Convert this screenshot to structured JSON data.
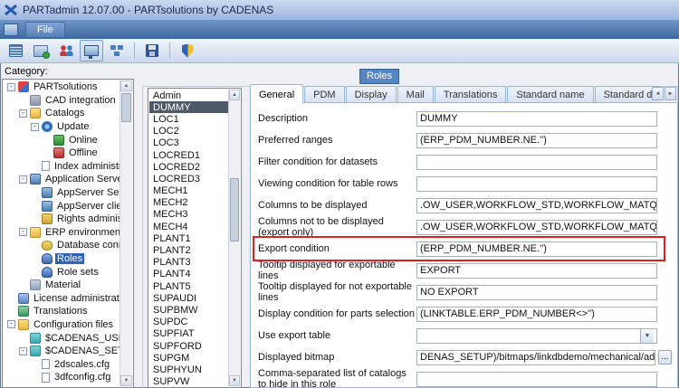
{
  "window": {
    "title": "PARTadmin 12.07.00 - PARTsolutions by CADENAS"
  },
  "menu": {
    "items": [
      {
        "label": "File"
      }
    ]
  },
  "toolbar": {
    "buttons": [
      {
        "name": "catalog-stack-icon"
      },
      {
        "name": "transfer-icon"
      },
      {
        "name": "users-icon"
      },
      {
        "name": "index-monitor-icon",
        "pressed": true
      },
      {
        "name": "network-icon"
      },
      {
        "separator": true
      },
      {
        "name": "save-icon"
      },
      {
        "separator": true
      },
      {
        "name": "shield-icon"
      }
    ]
  },
  "sidebar": {
    "category_label": "Category:",
    "tree": [
      {
        "label": "PARTsolutions",
        "level": 0,
        "expander": true,
        "icon": "app"
      },
      {
        "label": "CAD integration",
        "level": 1,
        "expander": false,
        "icon": "module"
      },
      {
        "label": "Catalogs",
        "level": 1,
        "expander": true,
        "icon": "folder"
      },
      {
        "label": "Update",
        "level": 2,
        "expander": true,
        "icon": "update"
      },
      {
        "label": "Online",
        "level": 3,
        "expander": false,
        "icon": "online"
      },
      {
        "label": "Offline",
        "level": 3,
        "expander": false,
        "icon": "offline"
      },
      {
        "label": "Index administration",
        "level": 2,
        "expander": false,
        "icon": "doc"
      },
      {
        "label": "Application Server",
        "level": 1,
        "expander": true,
        "icon": "server"
      },
      {
        "label": "AppServer Service",
        "level": 2,
        "expander": false,
        "icon": "server"
      },
      {
        "label": "AppServer client",
        "level": 2,
        "expander": false,
        "icon": "server"
      },
      {
        "label": "Rights administration",
        "level": 2,
        "expander": false,
        "icon": "key"
      },
      {
        "label": "ERP environment",
        "level": 1,
        "expander": true,
        "icon": "folder"
      },
      {
        "label": "Database connection",
        "level": 2,
        "expander": false,
        "icon": "db"
      },
      {
        "label": "Roles",
        "level": 2,
        "expander": false,
        "icon": "role",
        "selected": true
      },
      {
        "label": "Role sets",
        "level": 2,
        "expander": false,
        "icon": "role"
      },
      {
        "label": "Material",
        "level": 1,
        "expander": false,
        "icon": "material"
      },
      {
        "label": "License administration",
        "level": 0,
        "expander": false,
        "icon": "license"
      },
      {
        "label": "Translations",
        "level": 0,
        "expander": false,
        "icon": "trans"
      },
      {
        "label": "Configuration files",
        "level": 0,
        "expander": true,
        "icon": "folder"
      },
      {
        "label": "$CADENAS_USER",
        "level": 1,
        "expander": false,
        "icon": "folder-open"
      },
      {
        "label": "$CADENAS_SETUP",
        "level": 1,
        "expander": true,
        "icon": "folder-open"
      },
      {
        "label": "2dscales.cfg",
        "level": 2,
        "expander": false,
        "icon": "cfg"
      },
      {
        "label": "3dfconfig.cfg",
        "level": 2,
        "expander": false,
        "icon": "cfg"
      }
    ]
  },
  "group": {
    "title": "Roles"
  },
  "roles_list": {
    "selected": "DUMMY",
    "items": [
      "Admin",
      "DUMMY",
      "LOC1",
      "LOC2",
      "LOC3",
      "LOCRED1",
      "LOCRED2",
      "LOCRED3",
      "MECH1",
      "MECH2",
      "MECH3",
      "MECH4",
      "PLANT1",
      "PLANT2",
      "PLANT3",
      "PLANT4",
      "PLANT5",
      "SUPAUDI",
      "SUPBMW",
      "SUPDC",
      "SUPFIAT",
      "SUPFORD",
      "SUPGM",
      "SUPHYUN",
      "SUPVW"
    ]
  },
  "tabs": {
    "active": "General",
    "items": [
      "General",
      "PDM",
      "Display",
      "Mail",
      "Translations",
      "Standard name",
      "Standard designation"
    ]
  },
  "form": {
    "rows": [
      {
        "label": "Description",
        "value": "DUMMY",
        "type": "text"
      },
      {
        "label": "Preferred ranges",
        "value": "(ERP_PDM_NUMBER.NE.'')",
        "type": "text"
      },
      {
        "label": "Filter condition for datasets",
        "value": "",
        "type": "text"
      },
      {
        "label": "Viewing condition for table rows",
        "value": "",
        "type": "text"
      },
      {
        "label": "Columns to be displayed",
        "value": ".OW_USER,WORKFLOW_STD,WORKFLOW_MATQA,WORKFLOW_PD",
        "type": "text"
      },
      {
        "label": "Columns not to be displayed (export only)",
        "value": ".OW_USER,WORKFLOW_STD,WORKFLOW_MATQA,WORKFLOW_PD",
        "type": "text"
      },
      {
        "label": "Export condition",
        "value": "(ERP_PDM_NUMBER.NE.'')",
        "type": "text",
        "highlighted": true
      },
      {
        "label": "Tooltip displayed for exportable lines",
        "value": "EXPORT",
        "type": "text"
      },
      {
        "label": "Tooltip displayed for not exportable lines",
        "value": "NO EXPORT",
        "type": "text"
      },
      {
        "label": "Display condition for parts selection",
        "value": "(LINKTABLE.ERP_PDM_NUMBER<>'')",
        "type": "text"
      },
      {
        "label": "Use export table",
        "value": "",
        "type": "combo"
      },
      {
        "label": "Displayed bitmap",
        "value": "DENAS_SETUP)/bitmaps/linkdbdemo/mechanical/admin.bmp",
        "type": "file"
      },
      {
        "label": "Comma-separated list of catalogs to hide in this role",
        "value": "",
        "type": "text"
      }
    ]
  },
  "ui": {
    "expander_collapse_glyph": "-",
    "combo_arrow_glyph": "▼",
    "browse_label": "...",
    "scroll_up_glyph": "▲",
    "scroll_down_glyph": "▼",
    "scroll_left_glyph": "◄",
    "scroll_right_glyph": "►"
  },
  "colors": {
    "highlight_red": "#dd2020",
    "tree_selection": "#2f63b5",
    "list_selection": "#4f5a68",
    "badge_blue": "#5585c2"
  }
}
